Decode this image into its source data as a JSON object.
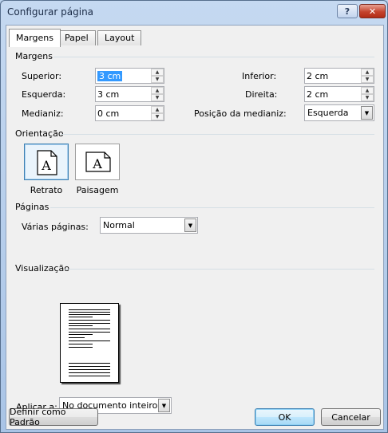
{
  "window": {
    "title": "Configurar página",
    "help": "?",
    "close": "✕"
  },
  "tabs": [
    {
      "label": "Margens"
    },
    {
      "label": "Papel"
    },
    {
      "label": "Layout"
    }
  ],
  "margins": {
    "section": "Margens",
    "superior": {
      "label": "Superior:",
      "value": "3 cm"
    },
    "esquerda": {
      "label": "Esquerda:",
      "value": "3 cm"
    },
    "medianiz": {
      "label": "Medianiz:",
      "value": "0 cm"
    },
    "inferior": {
      "label": "Inferior:",
      "value": "2 cm"
    },
    "direita": {
      "label": "Direita:",
      "value": "2 cm"
    },
    "posicao_medianiz": {
      "label": "Posição da medianiz:",
      "value": "Esquerda"
    }
  },
  "orientation": {
    "section": "Orientação",
    "portrait": "Retrato",
    "landscape": "Paisagem",
    "icon_letter": "A"
  },
  "pages": {
    "section": "Páginas",
    "multiple_label": "Várias páginas:",
    "multiple_value": "Normal"
  },
  "preview": {
    "section": "Visualização",
    "apply_label": "Aplicar a:",
    "apply_value": "No documento inteiro"
  },
  "buttons": {
    "set_default": "Definir como Padrão",
    "ok": "OK",
    "cancel": "Cancelar"
  }
}
